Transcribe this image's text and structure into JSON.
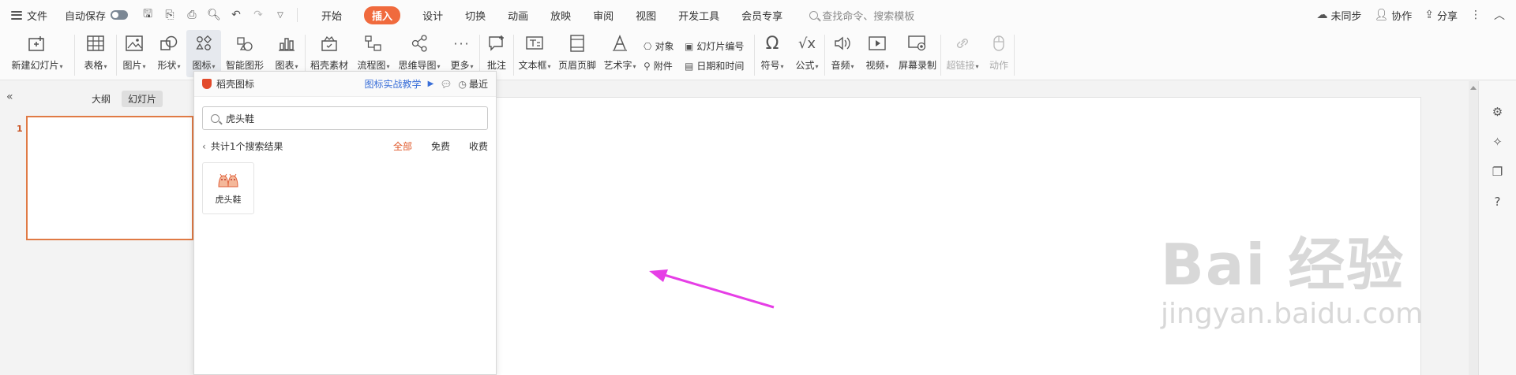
{
  "menubar": {
    "file_label": "文件",
    "autosave_label": "自动保存",
    "tabs": [
      {
        "label": "开始"
      },
      {
        "label": "插入"
      },
      {
        "label": "设计"
      },
      {
        "label": "切换"
      },
      {
        "label": "动画"
      },
      {
        "label": "放映"
      },
      {
        "label": "审阅"
      },
      {
        "label": "视图"
      },
      {
        "label": "开发工具"
      },
      {
        "label": "会员专享"
      }
    ],
    "search_placeholder": "查找命令、搜索模板",
    "sync_label": "未同步",
    "collab_label": "协作",
    "share_label": "分享"
  },
  "ribbon": {
    "new_slide": "新建幻灯片",
    "table": "表格",
    "picture": "图片",
    "shape": "形状",
    "icon": "图标",
    "smart_graphic": "智能图形",
    "chart": "图表",
    "docer_material": "稻壳素材",
    "flowchart": "流程图",
    "mindmap": "思维导图",
    "more": "更多",
    "comment": "批注",
    "textbox": "文本框",
    "header_footer": "页眉页脚",
    "wordart": "艺术字",
    "object": "对象",
    "attachment": "附件",
    "slide_number": "幻灯片编号",
    "datetime": "日期和时间",
    "symbol": "符号",
    "formula": "公式",
    "audio": "音频",
    "video": "视频",
    "screen_record": "屏幕录制",
    "hyperlink": "超链接",
    "action": "动作"
  },
  "leftpanel": {
    "outline_tab": "大纲",
    "slides_tab": "幻灯片",
    "slide_number": "1"
  },
  "popup": {
    "title": "稻壳图标",
    "tutorial_link": "图标实战教学",
    "recent_label": "最近",
    "search_value": "虎头鞋",
    "result_summary": "共计1个搜索结果",
    "filter_all": "全部",
    "filter_free": "免费",
    "filter_paid": "收费",
    "result_label": "虎头鞋"
  },
  "watermark": {
    "brand": "Bai 经验",
    "url": "jingyan.baidu.com"
  },
  "colors": {
    "accent": "#f06a3d",
    "link": "#3a6fd8",
    "arrow": "#e63ee6"
  }
}
